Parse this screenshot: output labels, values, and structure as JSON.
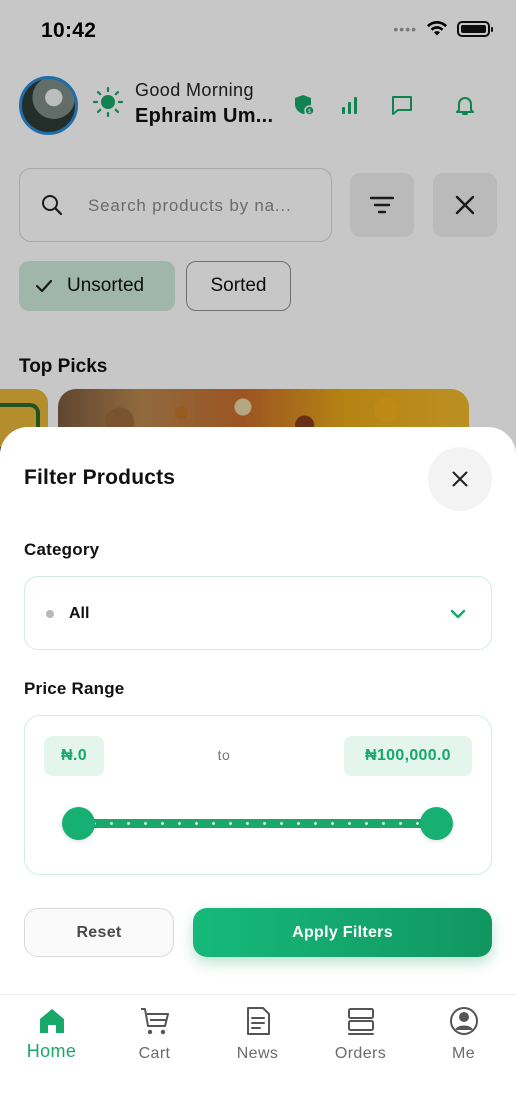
{
  "status_bar": {
    "time": "10:42",
    "signal_dots": "••••"
  },
  "header": {
    "greeting": "Good Morning",
    "username": "Ephraim Um..."
  },
  "search": {
    "placeholder": "Search products by na..."
  },
  "sort_chips": {
    "unsorted": "Unsorted",
    "sorted": "Sorted",
    "selected": "Unsorted"
  },
  "section_top_picks": "Top Picks",
  "filter_sheet": {
    "title": "Filter Products",
    "category_label": "Category",
    "category_value": "All",
    "price_label": "Price Range",
    "price_min": "₦.0",
    "price_to": "to",
    "price_max": "₦100,000.0",
    "slider_min_fraction": 0.0,
    "slider_max_fraction": 1.0,
    "reset_label": "Reset",
    "apply_label": "Apply Filters"
  },
  "bottom_nav": {
    "items": [
      {
        "label": "Home",
        "icon": "home-icon",
        "active": true
      },
      {
        "label": "Cart",
        "icon": "cart-icon",
        "active": false
      },
      {
        "label": "News",
        "icon": "news-icon",
        "active": false
      },
      {
        "label": "Orders",
        "icon": "orders-icon",
        "active": false
      },
      {
        "label": "Me",
        "icon": "profile-icon",
        "active": false
      }
    ]
  },
  "colors": {
    "accent": "#17a86a",
    "accent_light": "#e3f5ed",
    "chip_selected": "#cfe9dc",
    "avatar_ring": "#2a8dd6"
  }
}
